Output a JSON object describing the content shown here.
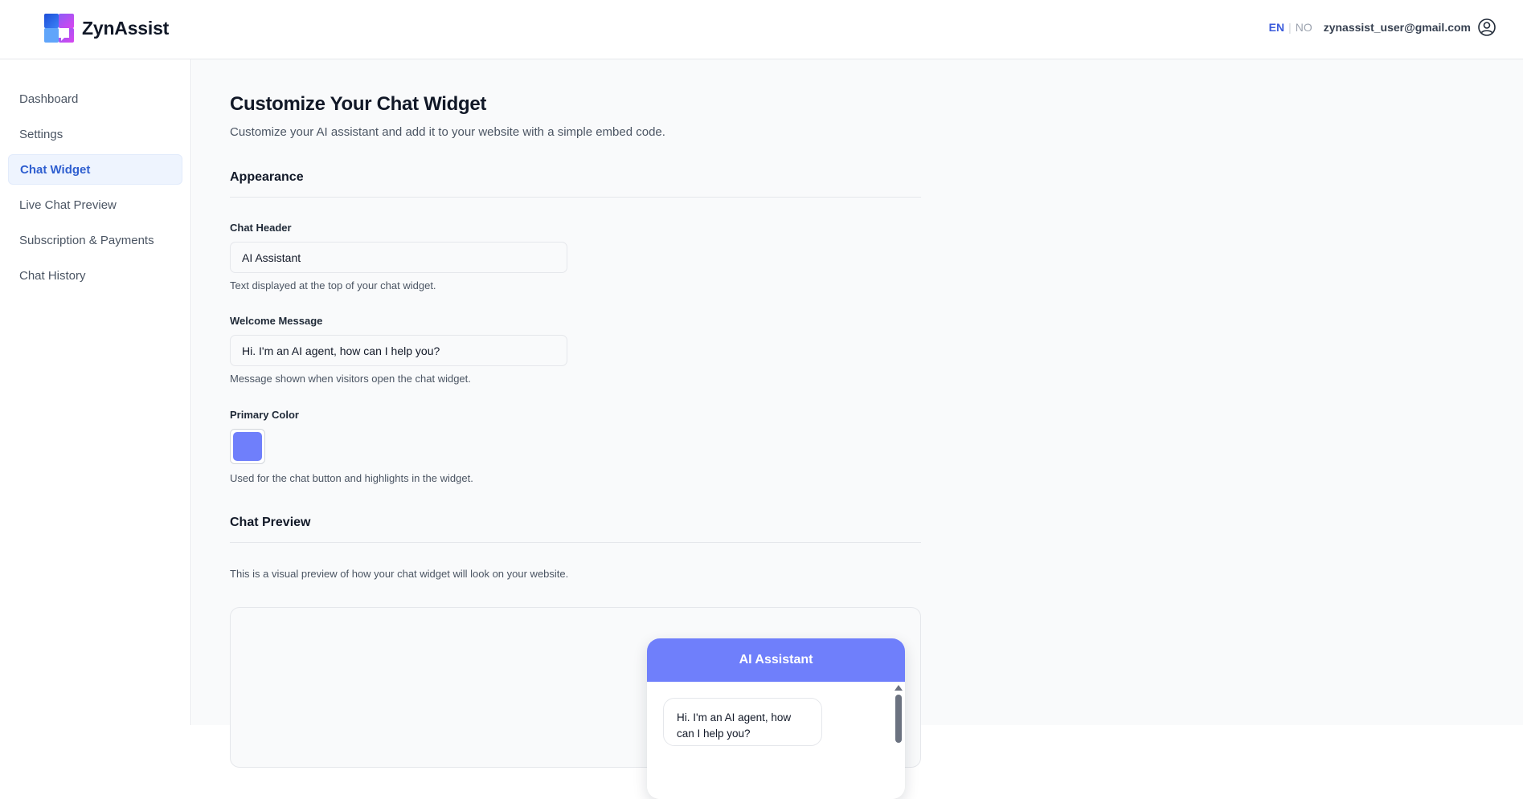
{
  "app": {
    "name": "ZynAssist",
    "logo_icon": "zynassist-logo-icon"
  },
  "header": {
    "lang_en": "EN",
    "lang_separator": "|",
    "lang_no": "NO",
    "user_email": "zynassist_user@gmail.com",
    "user_icon": "user-circle-icon"
  },
  "sidebar": {
    "items": [
      {
        "label": "Dashboard",
        "active": false
      },
      {
        "label": "Settings",
        "active": false
      },
      {
        "label": "Chat Widget",
        "active": true
      },
      {
        "label": "Live Chat Preview",
        "active": false
      },
      {
        "label": "Subscription & Payments",
        "active": false
      },
      {
        "label": "Chat History",
        "active": false
      }
    ]
  },
  "main": {
    "title": "Customize Your Chat Widget",
    "subtitle": "Customize your AI assistant and add it to your website with a simple embed code.",
    "appearance": {
      "section_title": "Appearance",
      "chat_header": {
        "label": "Chat Header",
        "value": "AI Assistant",
        "help": "Text displayed at the top of your chat widget."
      },
      "welcome_message": {
        "label": "Welcome Message",
        "value": "Hi. I'm an AI agent, how can I help you?",
        "help": "Message shown when visitors open the chat widget."
      },
      "primary_color": {
        "label": "Primary Color",
        "value": "#6f7ffb",
        "help": "Used for the chat button and highlights in the widget."
      }
    },
    "chat_preview": {
      "section_title": "Chat Preview",
      "description": "This is a visual preview of how your chat widget will look on your website.",
      "widget": {
        "header": "AI Assistant",
        "bubble_text": "Hi. I'm an AI agent, how can I help you?"
      }
    }
  },
  "colors": {
    "accent": "#2f5fd0",
    "primary": "#6f7ffb",
    "logo_blue": "#2563eb",
    "logo_purple": "#a855f7"
  }
}
